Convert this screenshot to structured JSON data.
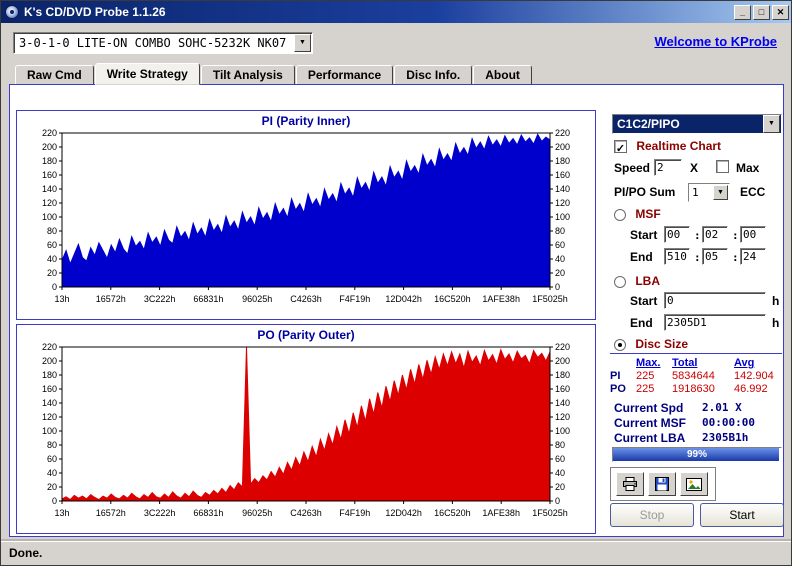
{
  "window": {
    "title": "K's CD/DVD Probe 1.1.26",
    "controls": {
      "minimize": "_",
      "maximize": "□",
      "close": "✕"
    }
  },
  "icons": {
    "check": "✓",
    "chevron": "▼"
  },
  "toolbar": {
    "device": "3-0-1-0 LITE-ON COMBO SOHC-5232K NK07",
    "link": "Welcome to KProbe"
  },
  "tabs": [
    {
      "label": "Raw Cmd",
      "active": false
    },
    {
      "label": "Write Strategy",
      "active": true
    },
    {
      "label": "Tilt Analysis",
      "active": false
    },
    {
      "label": "Performance",
      "active": false
    },
    {
      "label": "Disc Info.",
      "active": false
    },
    {
      "label": "About",
      "active": false
    }
  ],
  "panel": {
    "mode_select": "C1C2/PIPO",
    "realtime": {
      "label": "Realtime Chart",
      "checked": true
    },
    "speed": {
      "label": "Speed",
      "value": "2",
      "unit": "X",
      "max_label": "Max",
      "max_checked": false
    },
    "pipo_sum": {
      "label": "PI/PO Sum",
      "value": "1",
      "unit": "ECC"
    },
    "msf": {
      "label": "MSF",
      "selected": false,
      "sep": ":",
      "start_label": "Start",
      "start": [
        "00",
        "02",
        "00"
      ],
      "end_label": "End",
      "end": [
        "510",
        "05",
        "24"
      ]
    },
    "lba": {
      "label": "LBA",
      "selected": false,
      "unit": "h",
      "start_label": "Start",
      "start": "0",
      "end_label": "End",
      "end": "2305D1"
    },
    "disc_size": {
      "label": "Disc Size",
      "selected": true
    },
    "stats": {
      "headers": [
        "Max.",
        "Total",
        "Avg"
      ],
      "rows": [
        {
          "label": "PI",
          "max": "225",
          "total": "5834644",
          "avg": "142.904"
        },
        {
          "label": "PO",
          "max": "225",
          "total": "1918630",
          "avg": "46.992"
        }
      ]
    },
    "current": [
      {
        "label": "Current Spd",
        "value": "2.01 X"
      },
      {
        "label": "Current MSF",
        "value": "00:00:00"
      },
      {
        "label": "Current LBA",
        "value": "2305B1h"
      }
    ],
    "progress": {
      "percent": 99,
      "label": "99%"
    },
    "actions": {
      "stop": "Stop",
      "start": "Start"
    }
  },
  "status": "Done.",
  "chart_data": [
    {
      "type": "area",
      "title": "PI (Parity Inner)",
      "color": "#0000cc",
      "ylim": [
        0,
        220
      ],
      "ytick_step": 20,
      "x_labels": [
        "13h",
        "16572h",
        "3C222h",
        "66831h",
        "96025h",
        "C4263h",
        "F4F19h",
        "12D042h",
        "16C520h",
        "1AFE38h",
        "1F5025h"
      ],
      "values": [
        38,
        52,
        33,
        47,
        61,
        42,
        37,
        56,
        45,
        63,
        52,
        41,
        60,
        49,
        68,
        54,
        47,
        72,
        58,
        65,
        53,
        77,
        63,
        71,
        58,
        81,
        67,
        62,
        86,
        71,
        79,
        66,
        91,
        75,
        84,
        71,
        96,
        80,
        89,
        76,
        101,
        85,
        94,
        81,
        107,
        91,
        100,
        87,
        113,
        97,
        106,
        93,
        119,
        103,
        112,
        99,
        126,
        110,
        119,
        106,
        133,
        117,
        126,
        113,
        140,
        124,
        133,
        120,
        148,
        132,
        141,
        128,
        156,
        140,
        149,
        136,
        164,
        148,
        157,
        144,
        172,
        156,
        165,
        152,
        180,
        164,
        173,
        161,
        189,
        173,
        182,
        170,
        197,
        181,
        190,
        179,
        205,
        190,
        199,
        188,
        212,
        198,
        207,
        196,
        215,
        202,
        210,
        200,
        216,
        205,
        212,
        203,
        217,
        207,
        213,
        204,
        218,
        208,
        214,
        210
      ]
    },
    {
      "type": "area",
      "title": "PO (Parity Outer)",
      "color": "#dd0000",
      "ylim": [
        0,
        220
      ],
      "ytick_step": 20,
      "x_labels": [
        "13h",
        "16572h",
        "3C222h",
        "66831h",
        "96025h",
        "C4263h",
        "F4F19h",
        "12D042h",
        "16C520h",
        "1AFE38h",
        "1F5025h"
      ],
      "values": [
        3,
        6,
        2,
        8,
        4,
        7,
        3,
        9,
        5,
        2,
        7,
        4,
        10,
        5,
        3,
        8,
        4,
        11,
        6,
        3,
        9,
        5,
        12,
        6,
        4,
        10,
        5,
        13,
        7,
        4,
        11,
        6,
        14,
        8,
        5,
        12,
        8,
        15,
        10,
        18,
        12,
        22,
        16,
        26,
        20,
        222,
        24,
        32,
        26,
        36,
        30,
        42,
        34,
        48,
        38,
        55,
        44,
        62,
        50,
        70,
        56,
        78,
        63,
        88,
        72,
        96,
        80,
        106,
        88,
        116,
        96,
        126,
        105,
        136,
        114,
        146,
        124,
        155,
        133,
        164,
        142,
        172,
        151,
        180,
        159,
        188,
        167,
        195,
        174,
        201,
        181,
        206,
        188,
        210,
        193,
        213,
        196,
        210,
        190,
        214,
        198,
        207,
        193,
        215,
        200,
        209,
        195,
        216,
        202,
        210,
        197,
        214,
        203,
        208,
        196,
        215,
        205,
        211,
        200,
        213
      ]
    }
  ]
}
